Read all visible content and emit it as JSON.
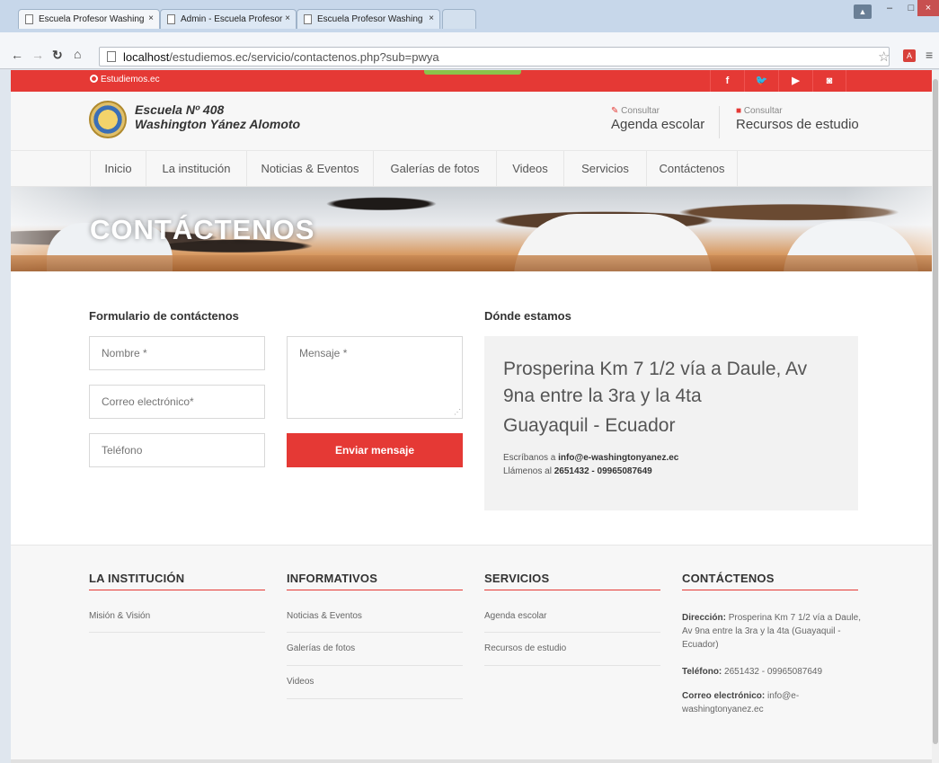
{
  "browser": {
    "tabs": [
      {
        "title": "Escuela Profesor Washing",
        "active": true
      },
      {
        "title": "Admin - Escuela Profesor",
        "active": false
      },
      {
        "title": "Escuela Profesor Washing",
        "active": false
      }
    ],
    "tab_close": "×",
    "url_host": "localhost",
    "url_path": "/estudiemos.ec/servicio/contactenos.php?sub=pwya",
    "window_controls": {
      "minimize": "–",
      "maximize": "□",
      "close": "×"
    }
  },
  "topbar": {
    "brand": "Estudiemos.ec",
    "social_icons": [
      "facebook-icon",
      "twitter-icon",
      "youtube-icon",
      "instagram-icon"
    ],
    "social_glyphs": [
      "f",
      "🐦",
      "▶",
      "◙"
    ],
    "color": "#e53935"
  },
  "header": {
    "school_line1": "Escuela Nº 408",
    "school_line2": "Washington Yánez Alomoto",
    "cta1": {
      "small": "Consultar",
      "big": "Agenda escolar"
    },
    "cta2": {
      "small": "Consultar",
      "big": "Recursos de estudio"
    }
  },
  "nav": [
    "Inicio",
    "La institución",
    "Noticias & Eventos",
    "Galerías de fotos",
    "Videos",
    "Servicios",
    "Contáctenos"
  ],
  "hero_title": "CONTÁCTENOS",
  "form": {
    "heading": "Formulario de contáctenos",
    "name_placeholder": "Nombre *",
    "email_placeholder": "Correo electrónico*",
    "phone_placeholder": "Teléfono",
    "message_placeholder": "Mensaje *",
    "submit": "Enviar mensaje"
  },
  "location": {
    "heading": "Dónde estamos",
    "address_lines": [
      "Prosperina Km 7 1/2 vía a Daule, Av",
      "9na entre la 3ra y la 4ta",
      "Guayaquil - Ecuador"
    ],
    "write_prefix": "Escríbanos a",
    "email": "info@e-washingtonyanez.ec",
    "call_prefix": "Llámenos al",
    "phones": "2651432 - 09965087649"
  },
  "footer": {
    "col1": {
      "title": "LA INSTITUCIÓN",
      "links": [
        "Misión & Visión"
      ]
    },
    "col2": {
      "title": "INFORMATIVOS",
      "links": [
        "Noticias & Eventos",
        "Galerías de fotos",
        "Videos"
      ]
    },
    "col3": {
      "title": "SERVICIOS",
      "links": [
        "Agenda escolar",
        "Recursos de estudio"
      ]
    },
    "col4": {
      "title": "CONTÁCTENOS",
      "address_label": "Dirección:",
      "address_value": "Prosperina Km 7 1/2 vía a Daule, Av 9na entre la 3ra y la 4ta (Guayaquil - Ecuador)",
      "phone_label": "Teléfono:",
      "phone_value": "2651432 - 09965087649",
      "email_label": "Correo electrónico:",
      "email_value": "info@e-washingtonyanez.ec"
    }
  }
}
